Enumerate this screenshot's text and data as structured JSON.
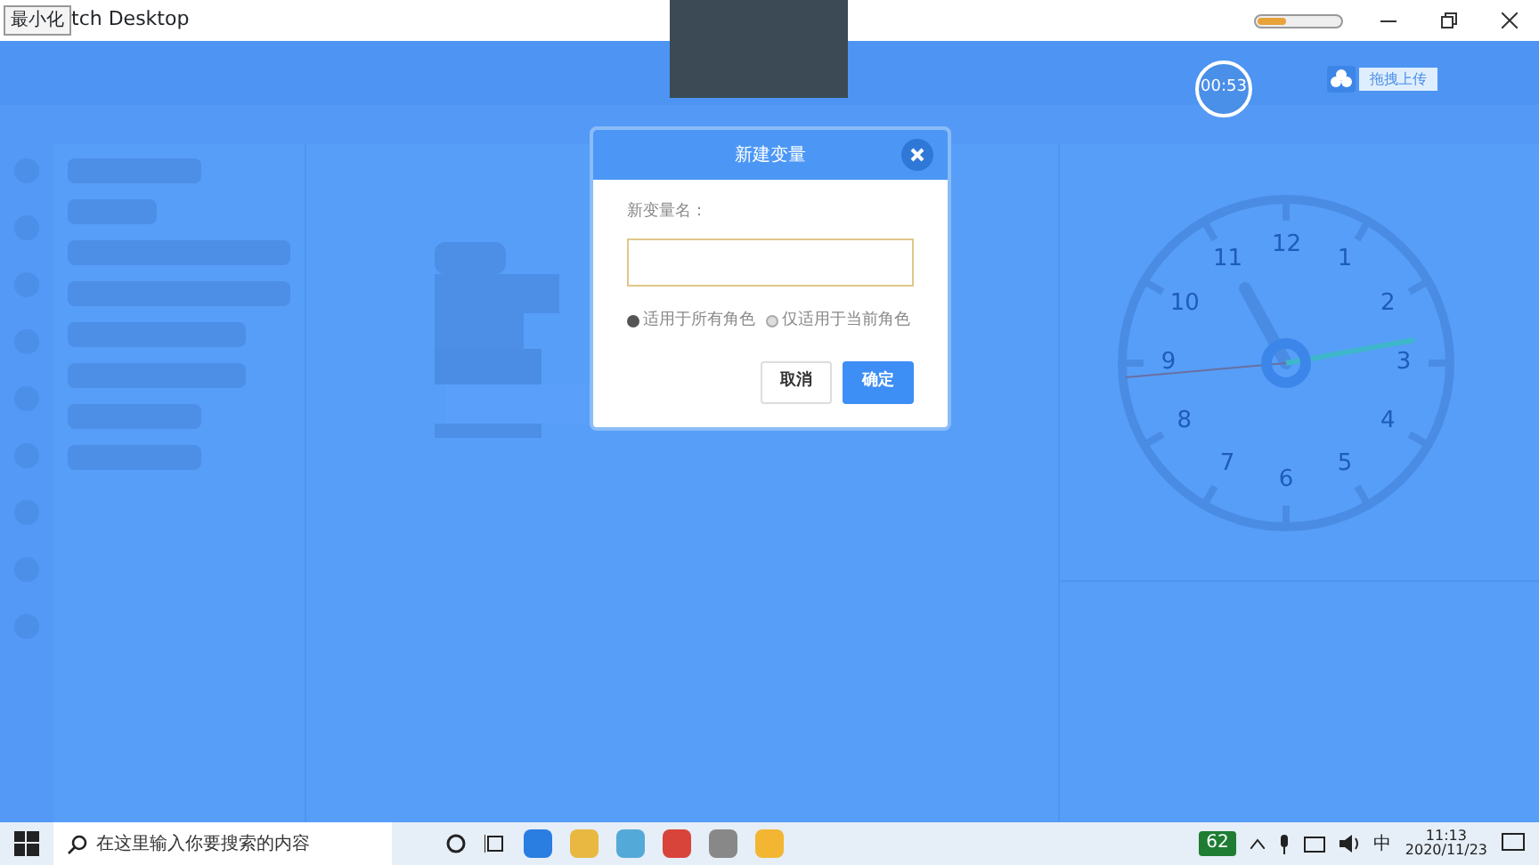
{
  "window": {
    "title": "tch Desktop",
    "tooltip": "最小化"
  },
  "timer": "00:53",
  "upload_button": "拖拽上传",
  "dialog": {
    "title": "新建变量",
    "field_label": "新变量名：",
    "scope_options": [
      {
        "label": "适用于所有角色",
        "selected": true
      },
      {
        "label": "仅适用于当前角色",
        "selected": false
      }
    ],
    "buttons": [
      {
        "label": "取消",
        "kind": "secondary"
      },
      {
        "label": "确定",
        "kind": "primary"
      }
    ]
  },
  "clock": {
    "numbers": [
      "12",
      "1",
      "2",
      "3",
      "4",
      "5",
      "6",
      "7",
      "8",
      "9",
      "10",
      "11"
    ]
  },
  "taskbar": {
    "search_placeholder": "在这里输入你要搜索的内容",
    "battery": "62",
    "ime": "中",
    "time": "11:13",
    "date": "2020/11/23"
  }
}
